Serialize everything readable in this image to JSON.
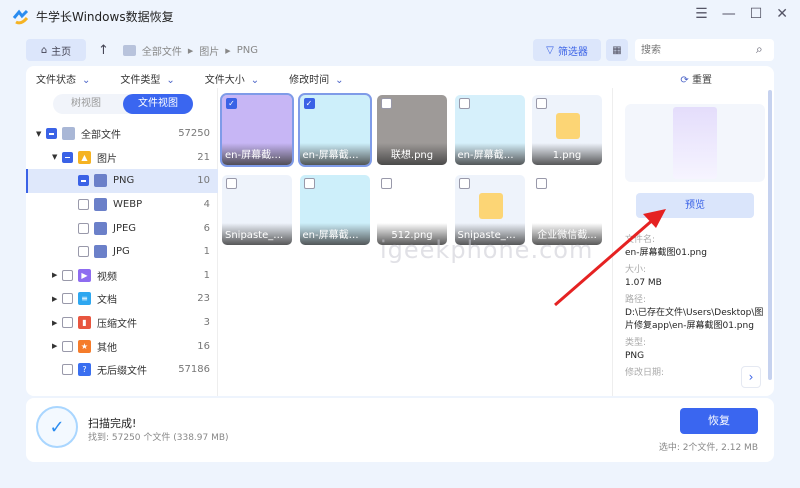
{
  "app": {
    "title": "牛学长Windows数据恢复"
  },
  "nav": {
    "home": "主页",
    "crumbs": [
      "全部文件",
      "图片",
      "PNG"
    ],
    "filter": "筛选器",
    "search_placeholder": "搜索"
  },
  "filters": {
    "items": [
      "文件状态",
      "文件类型",
      "文件大小",
      "修改时间"
    ],
    "reset": "重置"
  },
  "sidebar": {
    "tabs": [
      "树视图",
      "文件视图"
    ],
    "active_tab": 1,
    "items": [
      {
        "label": "全部文件",
        "count": "57250",
        "level": 0,
        "arrow": "▼",
        "state": "part",
        "icon": "monitor-icon",
        "color": "#a9b7d6"
      },
      {
        "label": "图片",
        "count": "21",
        "level": 1,
        "arrow": "▼",
        "state": "part",
        "icon": "image-icon",
        "color": "#f5b323"
      },
      {
        "label": "PNG",
        "count": "10",
        "level": 2,
        "arrow": "",
        "state": "part",
        "icon": "folder-icon",
        "color": "#6b80c9",
        "selected": true
      },
      {
        "label": "WEBP",
        "count": "4",
        "level": 2,
        "arrow": "",
        "state": "none",
        "icon": "folder-icon",
        "color": "#6b80c9"
      },
      {
        "label": "JPEG",
        "count": "6",
        "level": 2,
        "arrow": "",
        "state": "none",
        "icon": "folder-icon",
        "color": "#6b80c9"
      },
      {
        "label": "JPG",
        "count": "1",
        "level": 2,
        "arrow": "",
        "state": "none",
        "icon": "folder-icon",
        "color": "#6b80c9"
      },
      {
        "label": "视频",
        "count": "1",
        "level": 1,
        "arrow": "▶",
        "state": "none",
        "icon": "video-icon",
        "color": "#8e6cf0"
      },
      {
        "label": "文档",
        "count": "23",
        "level": 1,
        "arrow": "▶",
        "state": "none",
        "icon": "document-icon",
        "color": "#2ea7f0"
      },
      {
        "label": "压缩文件",
        "count": "3",
        "level": 1,
        "arrow": "▶",
        "state": "none",
        "icon": "archive-icon",
        "color": "#e8563f"
      },
      {
        "label": "其他",
        "count": "16",
        "level": 1,
        "arrow": "▶",
        "state": "none",
        "icon": "star-icon",
        "color": "#f57c2b"
      },
      {
        "label": "无后缀文件",
        "count": "57186",
        "level": 1,
        "arrow": "",
        "state": "none",
        "icon": "question-icon",
        "color": "#3a6ff0"
      }
    ]
  },
  "files": [
    {
      "name": "en-屏幕截图...",
      "checked": true,
      "bg": "#c7b6f5"
    },
    {
      "name": "en-屏幕截图...",
      "checked": true,
      "bg": "#cdeffa"
    },
    {
      "name": "联想.png",
      "checked": false,
      "bg": "#9e9a98"
    },
    {
      "name": "en-屏幕截图...",
      "checked": false,
      "bg": "#d6f0fb"
    },
    {
      "name": "1.png",
      "checked": false,
      "bg": "#eef3fb",
      "placeholder": true
    },
    {
      "name": "Snipaste_2...",
      "checked": false,
      "bg": "#eef3fb"
    },
    {
      "name": "en-屏幕截图...",
      "checked": false,
      "bg": "#cdeffa"
    },
    {
      "name": "512.png",
      "checked": false,
      "bg": "#ffffff"
    },
    {
      "name": "Snipaste_2...",
      "checked": false,
      "bg": "#eef3fb",
      "placeholder": true
    },
    {
      "name": "企业微信截...",
      "checked": false,
      "bg": "#ffffff"
    }
  ],
  "details": {
    "preview": "预览",
    "name_label": "文件名:",
    "name": "en-屏幕截图01.png",
    "size_label": "大小:",
    "size": "1.07 MB",
    "path_label": "路径:",
    "path": "D:\\已存在文件\\Users\\Desktop\\图片修复app\\en-屏幕截图01.png",
    "type_label": "类型:",
    "type": "PNG",
    "date_label": "修改日期:"
  },
  "footer": {
    "status": "扫描完成!",
    "found": "找到: 57250 个文件 (338.97 MB)",
    "recover": "恢复",
    "selected": "选中: 2个文件, 2.12 MB"
  },
  "watermark": "igeekphone.com",
  "colors": {
    "accent": "#3a66f0",
    "annotation_arrow": "#e52222"
  }
}
